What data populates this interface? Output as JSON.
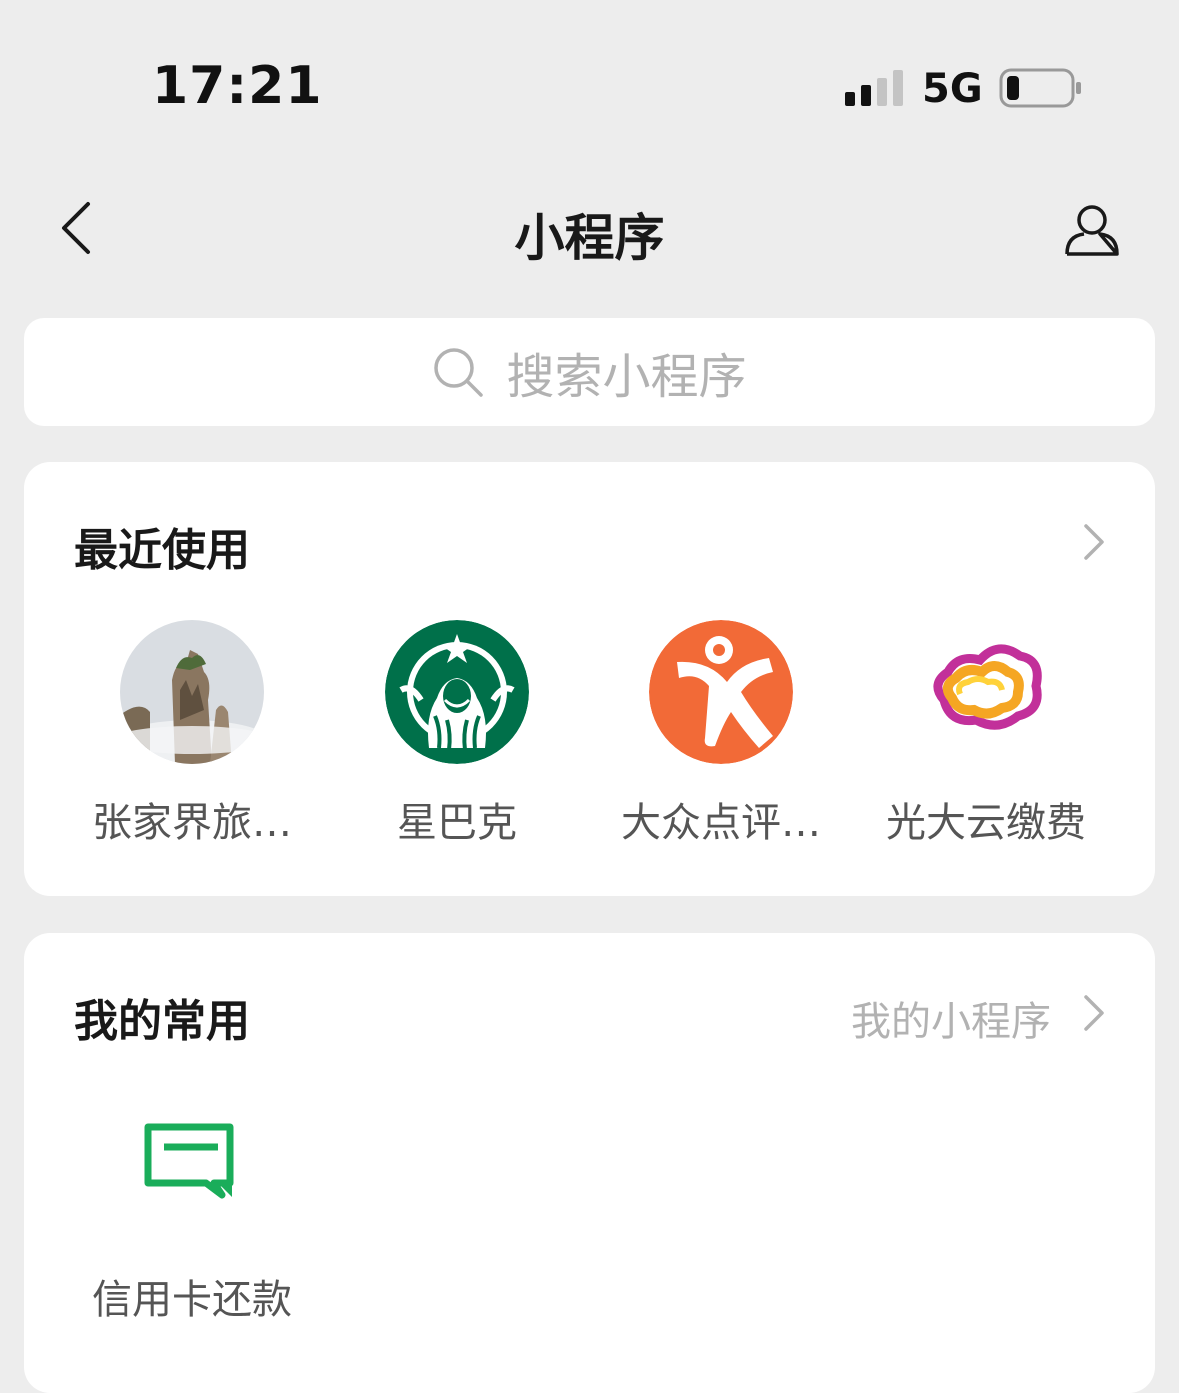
{
  "status_bar": {
    "time": "17:21",
    "network": "5G"
  },
  "nav": {
    "title": "小程序"
  },
  "search": {
    "placeholder": "搜索小程序"
  },
  "recent": {
    "title": "最近使用",
    "apps": [
      {
        "label": "张家界旅…"
      },
      {
        "label": "星巴克"
      },
      {
        "label": "大众点评…"
      },
      {
        "label": "光大云缴费"
      }
    ]
  },
  "favorites": {
    "title": "我的常用",
    "more_label": "我的小程序",
    "apps": [
      {
        "label": "信用卡还款"
      }
    ]
  },
  "colors": {
    "background": "#ededed",
    "card": "#ffffff",
    "starbucks_green": "#00704a",
    "dianping_orange": "#f26a37",
    "credit_green": "#1aad5a"
  }
}
